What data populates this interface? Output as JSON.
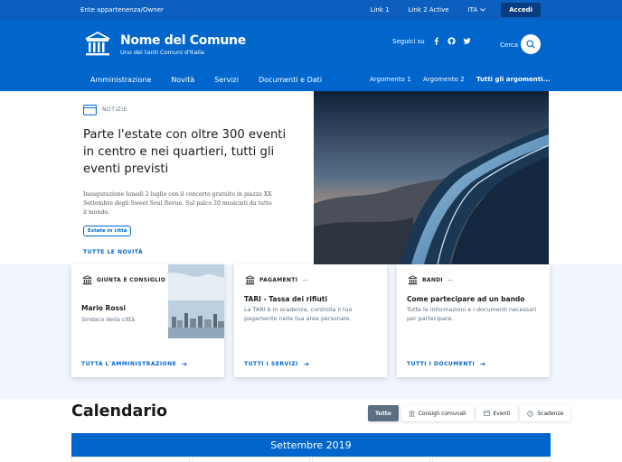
{
  "slim_header": {
    "owner": "Ente appartenenza/Owner",
    "links": [
      "Link 1",
      "Link 2 Active"
    ],
    "lang": "ITA",
    "login": "Accedi"
  },
  "brand": {
    "title": "Nome del Comune",
    "subtitle": "Uno dei tanti Comuni d'Italia"
  },
  "social": {
    "label": "Seguici su",
    "icons": [
      "facebook-icon",
      "github-icon",
      "twitter-icon"
    ]
  },
  "search": {
    "label": "Cerca"
  },
  "nav": {
    "items": [
      "Amministrazione",
      "Novità",
      "Servizi",
      "Documenti e Dati"
    ],
    "secondary": [
      "Argomento 1",
      "Argomento 2",
      "Tutti gli argomenti..."
    ]
  },
  "hero": {
    "category": "NOTIZIE",
    "title": "Parte l'estate con oltre 300 eventi in centro e nei quartieri, tutti gli eventi previsti",
    "description": "Inaugurazione lunedì 2 luglio con il concerto gratuito in piazza XX Settembre degli Sweet Soul Revue. Sul palco 20 musicisti da tutto il mondo.",
    "chip": "Estate in città",
    "link": "TUTTE LE NOVITÀ"
  },
  "cards": [
    {
      "category": "GIUNTA E CONSIGLIO",
      "title": "Mario Rossi",
      "text": "Sindaco della città",
      "link": "TUTTA L'AMMINISTRAZIONE"
    },
    {
      "category": "PAGAMENTI",
      "title": "TARI - Tassa dei rifiuti",
      "text": "La TARI è in scadenza, controlla il tuo pagamento nella tua area personale.",
      "link": "TUTTI I SERVIZI"
    },
    {
      "category": "BANDI",
      "title": "Come partecipare ad un bando",
      "text": "Tutte le informazioni e i documenti necessari per partecipare.",
      "link": "TUTTI I DOCUMENTI"
    }
  ],
  "calendar": {
    "title": "Calendario",
    "filters": [
      "Tutto",
      "Consigli comunali",
      "Eventi",
      "Scadenze"
    ],
    "active_filter": "Tutto",
    "month": "Settembre 2019"
  },
  "colors": {
    "primary": "#0066cc",
    "slim": "#0d5fbf",
    "muted": "#5c6f82"
  }
}
